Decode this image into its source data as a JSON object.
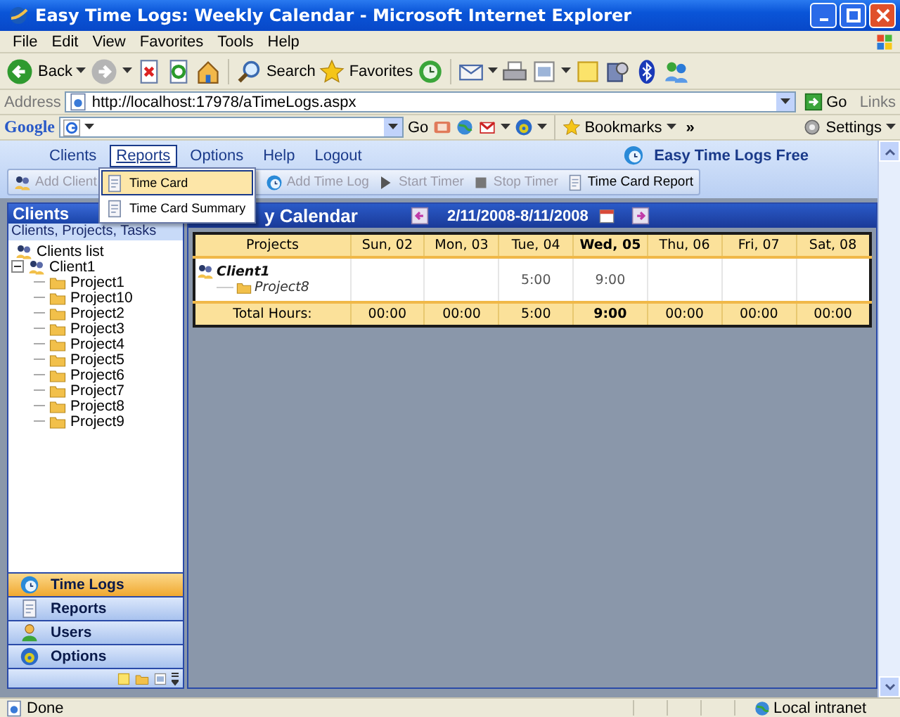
{
  "window": {
    "title": "Easy Time Logs: Weekly Calendar - Microsoft Internet Explorer"
  },
  "menu_bar": [
    "File",
    "Edit",
    "View",
    "Favorites",
    "Tools",
    "Help"
  ],
  "toolbar": {
    "back": "Back",
    "search": "Search",
    "favorites": "Favorites"
  },
  "address_bar": {
    "label": "Address",
    "url": "http://localhost:17978/aTimeLogs.aspx",
    "go": "Go",
    "links": "Links"
  },
  "google_bar": {
    "logo": "Google",
    "go": "Go",
    "bookmarks": "Bookmarks",
    "more": "»",
    "settings": "Settings"
  },
  "app_menu": [
    {
      "label": "Clients",
      "selected": false
    },
    {
      "label": "Reports",
      "selected": true
    },
    {
      "label": "Options",
      "selected": false
    },
    {
      "label": "Help",
      "selected": false
    },
    {
      "label": "Logout",
      "selected": false
    }
  ],
  "app_logo": "Easy Time Logs Free",
  "reports_menu": [
    {
      "label": "Time Card",
      "selected": true
    },
    {
      "label": "Time Card Summary",
      "selected": false
    }
  ],
  "app_toolbar": [
    {
      "label": "Add Client",
      "disabled": true
    },
    {
      "label": "Add Time Log",
      "disabled": true
    },
    {
      "label": "Start Timer",
      "disabled": true
    },
    {
      "label": "Stop Timer",
      "disabled": true
    },
    {
      "label": "Time Card Report",
      "disabled": false
    }
  ],
  "sidebar": {
    "title": "Clients",
    "subtitle": "Clients, Projects, Tasks",
    "tree": [
      {
        "label": "Clients list",
        "kind": "root"
      },
      {
        "label": "Client1",
        "kind": "client",
        "expanded": true,
        "children": [
          {
            "label": "Project1"
          },
          {
            "label": "Project10"
          },
          {
            "label": "Project2"
          },
          {
            "label": "Project3"
          },
          {
            "label": "Project4"
          },
          {
            "label": "Project5"
          },
          {
            "label": "Project6"
          },
          {
            "label": "Project7"
          },
          {
            "label": "Project8"
          },
          {
            "label": "Project9"
          }
        ]
      }
    ],
    "nav": [
      {
        "label": "Time Logs",
        "selected": true
      },
      {
        "label": "Reports",
        "selected": false
      },
      {
        "label": "Users",
        "selected": false
      },
      {
        "label": "Options",
        "selected": false
      }
    ]
  },
  "calendar": {
    "title": "y Calendar",
    "date_range": "2/11/2008-8/11/2008",
    "columns": [
      {
        "label": "Projects",
        "selected": false
      },
      {
        "label": "Sun, 02",
        "selected": false
      },
      {
        "label": "Mon, 03",
        "selected": false
      },
      {
        "label": "Tue, 04",
        "selected": false
      },
      {
        "label": "Wed, 05",
        "selected": true
      },
      {
        "label": "Thu, 06",
        "selected": false
      },
      {
        "label": "Fri, 07",
        "selected": false
      },
      {
        "label": "Sat, 08",
        "selected": false
      }
    ],
    "rows": [
      {
        "client": "Client1",
        "project": "Project8",
        "hours": {
          "tue": "5:00",
          "wed": "9:00"
        }
      }
    ],
    "totals": {
      "label": "Total Hours:",
      "values": [
        "00:00",
        "00:00",
        "5:00",
        "9:00",
        "00:00",
        "00:00",
        "00:00"
      ]
    }
  },
  "status_bar": {
    "text": "Done",
    "zone": "Local intranet"
  }
}
